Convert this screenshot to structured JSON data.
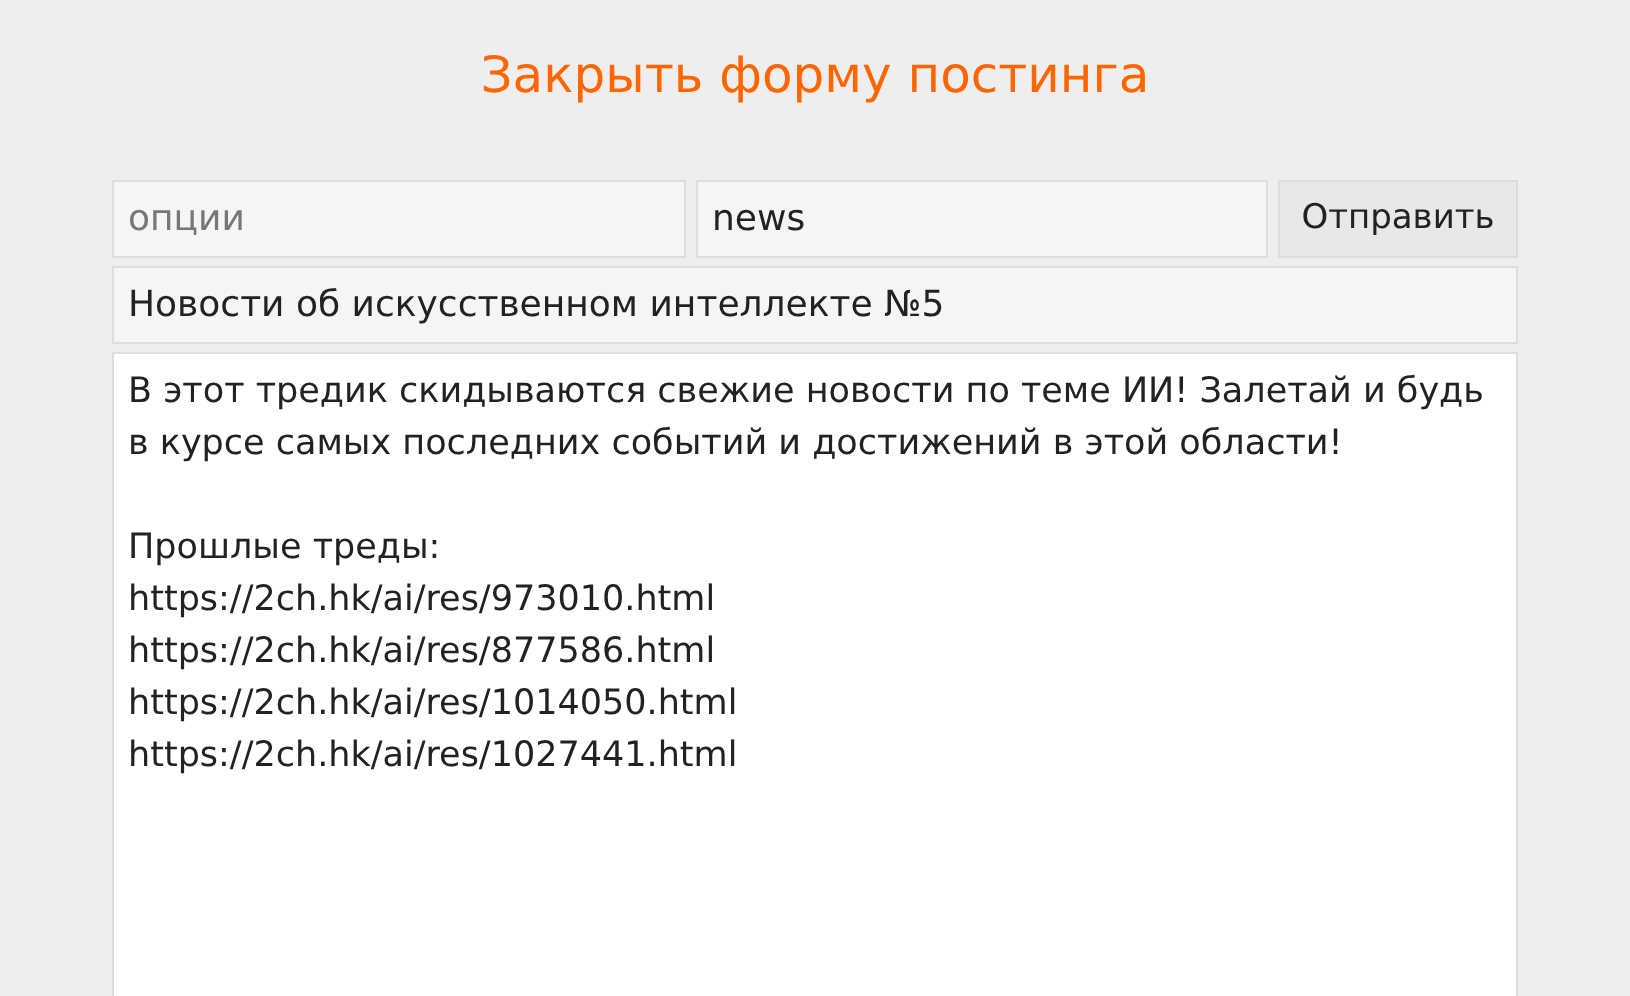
{
  "close_link": "Закрыть форму постинга",
  "options": {
    "placeholder": "опции"
  },
  "email": {
    "value": "news"
  },
  "submit_button": "Отправить",
  "subject": {
    "value": "Новости об искусственном интеллекте №5"
  },
  "message": {
    "value": "В этот тредик скидываются свежие новости по теме ИИ! Залетай и будь в курсе самых последних событий и достижений в этой области!\n\nПрошлые треды:\nhttps://2ch.hk/ai/res/973010.html\nhttps://2ch.hk/ai/res/877586.html\nhttps://2ch.hk/ai/res/1014050.html\nhttps://2ch.hk/ai/res/1027441.html"
  }
}
